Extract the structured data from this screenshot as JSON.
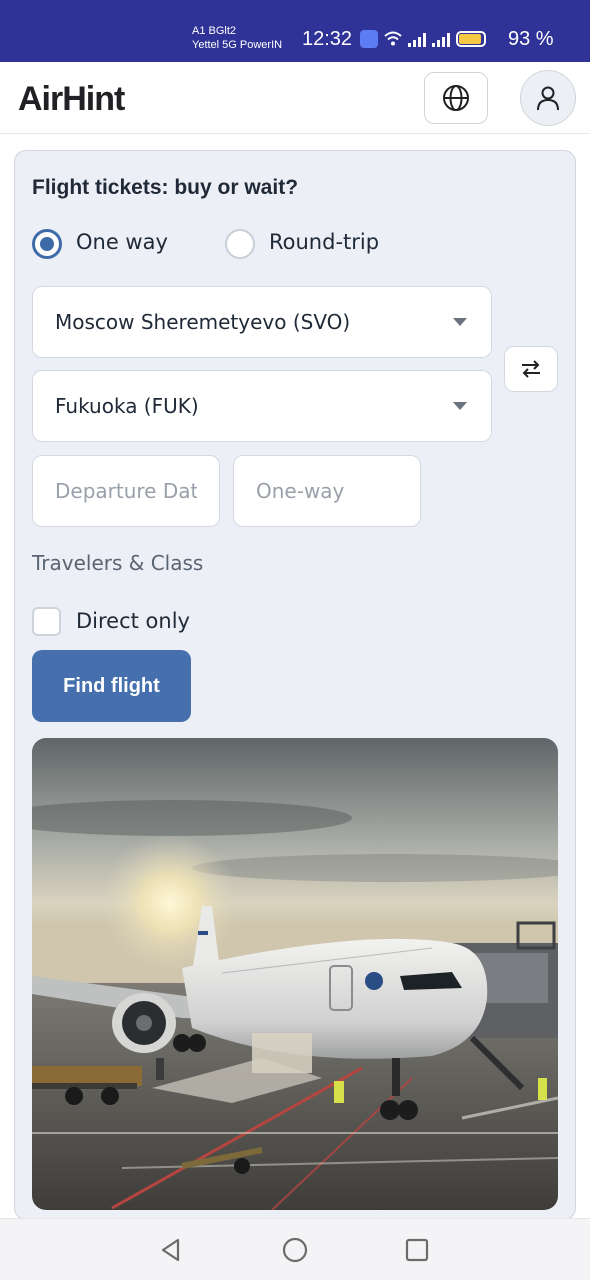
{
  "status_bar": {
    "carrier_line1": "A1 BGlt2",
    "carrier_line2": "Yettel 5G PowerIN",
    "time": "12:32",
    "battery_percent": "93 %",
    "battery_level": 0.93,
    "icons": [
      "app-notification-icon",
      "wifi-icon",
      "signal-icon",
      "signal-icon",
      "battery-icon"
    ]
  },
  "header": {
    "logo": "AirHint",
    "language_button_icon": "globe-icon",
    "account_button_icon": "user-icon"
  },
  "form": {
    "title": "Flight tickets: buy or wait?",
    "trip_type": {
      "options": [
        {
          "label": "One way",
          "selected": true
        },
        {
          "label": "Round-trip",
          "selected": false
        }
      ]
    },
    "origin": "Moscow Sheremetyevo (SVO)",
    "destination": "Fukuoka (FUK)",
    "swap_icon": "swap-arrows-icon",
    "departure_placeholder": "Departure Date",
    "return_placeholder": "One-way",
    "travelers_label": "Travelers & Class",
    "direct_only_label": "Direct only",
    "direct_only_checked": false,
    "submit_label": "Find flight"
  },
  "image": {
    "subject": "airplane-at-gate-photo"
  },
  "nav": {
    "icons": [
      "back-triangle-icon",
      "home-circle-icon",
      "recents-square-icon"
    ]
  },
  "colors": {
    "status_bar": "#2f3296",
    "accent": "#4670ad",
    "card_bg": "#eceff6"
  }
}
